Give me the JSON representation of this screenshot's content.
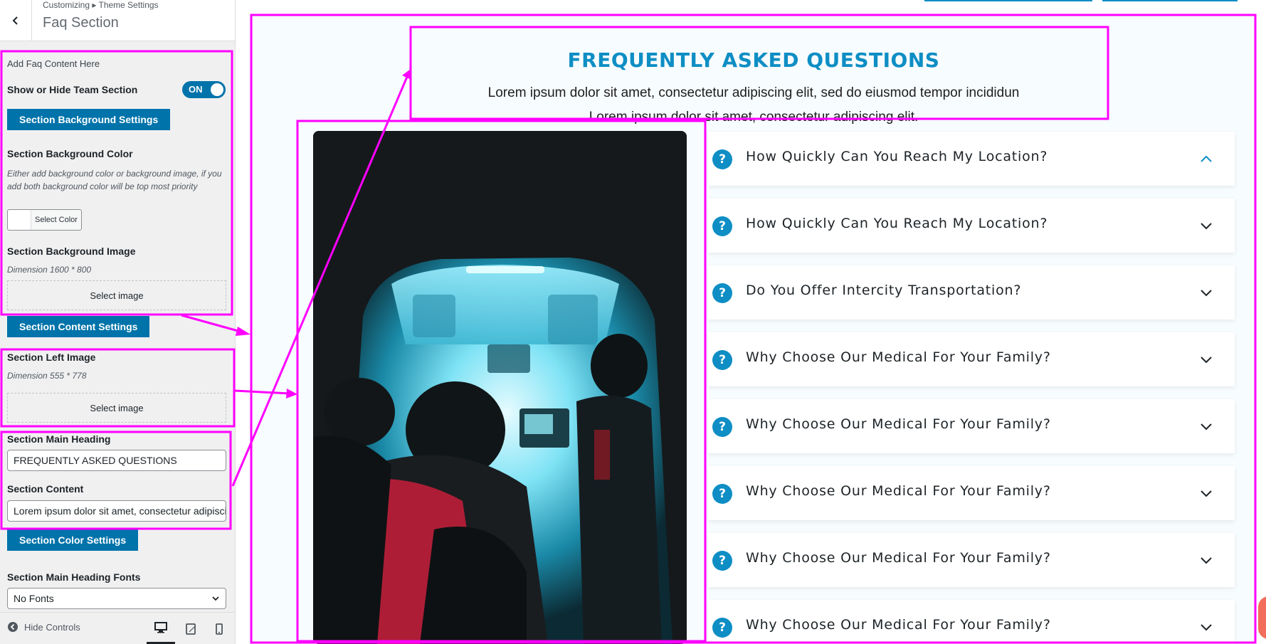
{
  "header": {
    "breadcrumb": "Customizing ▸ Theme Settings",
    "title": "Faq Section"
  },
  "panel": {
    "intro": "Add Faq Content Here",
    "show_hide_label": "Show or Hide Team Section",
    "toggle_state": "ON",
    "bg_settings_button": "Section Background Settings",
    "bg_color_label": "Section Background Color",
    "bg_color_hint": "Either add background color or background image, if you add both background color will be top most priority",
    "select_color_button": "Select Color",
    "bg_image_label": "Section Background Image",
    "bg_image_dimension": "Dimension 1600 * 800",
    "select_image_button": "Select image",
    "content_settings_button": "Section Content Settings",
    "left_image_label": "Section Left Image",
    "left_image_dimension": "Dimension 555 * 778",
    "main_heading_label": "Section Main Heading",
    "main_heading_value": "FREQUENTLY ASKED QUESTIONS",
    "content_label": "Section Content",
    "content_value": "Lorem ipsum dolor sit amet, consectetur adipiscing elit, sed do eiusmod tempor incididun",
    "color_settings_button": "Section Color Settings",
    "heading_fonts_label": "Section Main Heading Fonts",
    "heading_fonts_value": "No Fonts"
  },
  "footer": {
    "hide_controls": "Hide Controls",
    "devices": [
      "desktop-icon",
      "tablet-icon",
      "mobile-icon"
    ]
  },
  "preview": {
    "title": "FREQUENTLY ASKED QUESTIONS",
    "content_line1": "Lorem ipsum dolor sit amet, consectetur adipiscing elit, sed do eiusmod tempor incididun",
    "content_line2": "Lorem ipsum dolor sit amet, consectetur adipiscing elit.",
    "question_icon": "?",
    "faqs": [
      {
        "question": "How Quickly Can You Reach My Location?",
        "expanded": true
      },
      {
        "question": "How Quickly Can You Reach My Location?",
        "expanded": false
      },
      {
        "question": "Do You Offer Intercity Transportation?",
        "expanded": false
      },
      {
        "question": "Why Choose Our Medical For Your Family?",
        "expanded": false
      },
      {
        "question": "Why Choose Our Medical For Your Family?",
        "expanded": false
      },
      {
        "question": "Why Choose Our Medical For Your Family?",
        "expanded": false
      },
      {
        "question": "Why Choose Our Medical For Your Family?",
        "expanded": false
      },
      {
        "question": "Why Choose Our Medical For Your Family?",
        "expanded": false
      }
    ]
  },
  "colors": {
    "accent": "#0e8ec4",
    "wp_blue": "#0073aa",
    "annotation": "#ff00ff"
  }
}
